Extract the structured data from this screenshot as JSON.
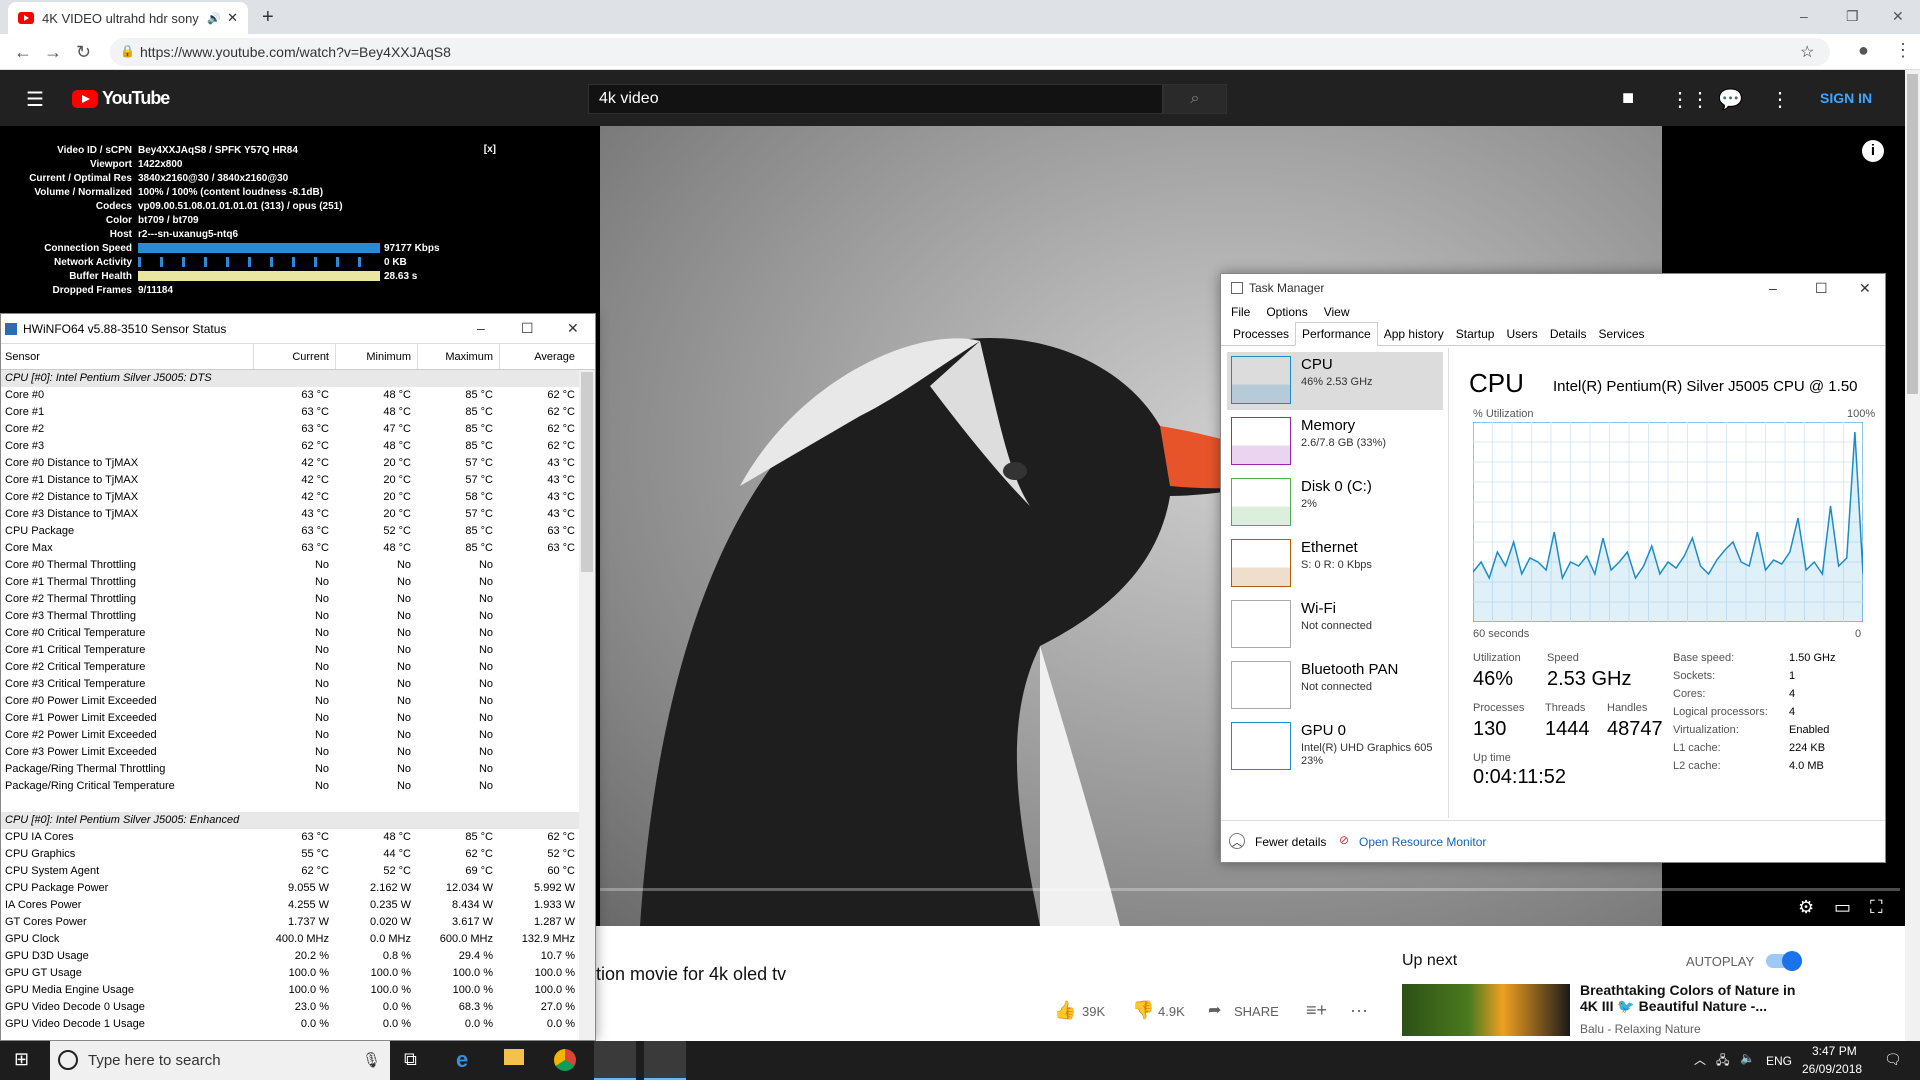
{
  "browser": {
    "tab_title": "4K VIDEO ultrahd hdr sony 4",
    "new_tab": "+",
    "url": "https://www.youtube.com/watch?v=Bey4XXJAqS8",
    "icons": {
      "back": "arrow-left",
      "forward": "arrow-right",
      "reload": "reload",
      "lock": "lock",
      "star": "star",
      "account": "account",
      "menu": "kebab"
    },
    "window_controls": [
      "–",
      "❐",
      "✕"
    ]
  },
  "youtube": {
    "logo": "YouTube",
    "search_value": "4k video",
    "signin": "SIGN IN",
    "video_title_partial": "tion movie for 4k oled tv",
    "likes": "39K",
    "dislikes": "4.9K",
    "share": "SHARE",
    "up_next": "Up next",
    "autoplay": "AUTOPLAY",
    "next_title": "Breathtaking Colors of Nature in 4K III 🐦 Beautiful Nature -...",
    "next_channel": "Balu - Relaxing Nature",
    "close_stats": "[x]"
  },
  "stats": [
    {
      "k": "Video ID / sCPN",
      "v": "Bey4XXJAqS8 / SPFK Y57Q HR84"
    },
    {
      "k": "Viewport",
      "v": "1422x800"
    },
    {
      "k": "Current / Optimal Res",
      "v": "3840x2160@30 / 3840x2160@30"
    },
    {
      "k": "Volume / Normalized",
      "v": "100% / 100% (content loudness -8.1dB)"
    },
    {
      "k": "Codecs",
      "v": "vp09.00.51.08.01.01.01.01 (313) / opus (251)"
    },
    {
      "k": "Color",
      "v": "bt709 / bt709"
    },
    {
      "k": "Host",
      "v": "r2---sn-uxanug5-ntq6"
    },
    {
      "k": "Connection Speed",
      "v": "97177 Kbps"
    },
    {
      "k": "Network Activity",
      "v": "0 KB"
    },
    {
      "k": "Buffer Health",
      "v": "28.63 s"
    },
    {
      "k": "Dropped Frames",
      "v": "9/11184"
    }
  ],
  "hwinfo": {
    "title": "HWiNFO64 v5.88-3510 Sensor Status",
    "headers": [
      "Sensor",
      "Current",
      "Minimum",
      "Maximum",
      "Average"
    ],
    "rows": [
      {
        "g": true,
        "n": "CPU [#0]: Intel Pentium Silver J5005: DTS"
      },
      {
        "n": "Core #0",
        "c": "63 °C",
        "mi": "48 °C",
        "ma": "85 °C",
        "a": "62 °C"
      },
      {
        "n": "Core #1",
        "c": "63 °C",
        "mi": "48 °C",
        "ma": "85 °C",
        "a": "62 °C"
      },
      {
        "n": "Core #2",
        "c": "63 °C",
        "mi": "47 °C",
        "ma": "85 °C",
        "a": "62 °C"
      },
      {
        "n": "Core #3",
        "c": "62 °C",
        "mi": "48 °C",
        "ma": "85 °C",
        "a": "62 °C"
      },
      {
        "n": "Core #0 Distance to TjMAX",
        "c": "42 °C",
        "mi": "20 °C",
        "ma": "57 °C",
        "a": "43 °C"
      },
      {
        "n": "Core #1 Distance to TjMAX",
        "c": "42 °C",
        "mi": "20 °C",
        "ma": "57 °C",
        "a": "43 °C"
      },
      {
        "n": "Core #2 Distance to TjMAX",
        "c": "42 °C",
        "mi": "20 °C",
        "ma": "58 °C",
        "a": "43 °C"
      },
      {
        "n": "Core #3 Distance to TjMAX",
        "c": "43 °C",
        "mi": "20 °C",
        "ma": "57 °C",
        "a": "43 °C"
      },
      {
        "n": "CPU Package",
        "c": "63 °C",
        "mi": "52 °C",
        "ma": "85 °C",
        "a": "63 °C"
      },
      {
        "n": "Core Max",
        "c": "63 °C",
        "mi": "48 °C",
        "ma": "85 °C",
        "a": "63 °C"
      },
      {
        "n": "Core #0 Thermal Throttling",
        "c": "No",
        "mi": "No",
        "ma": "No",
        "a": ""
      },
      {
        "n": "Core #1 Thermal Throttling",
        "c": "No",
        "mi": "No",
        "ma": "No",
        "a": ""
      },
      {
        "n": "Core #2 Thermal Throttling",
        "c": "No",
        "mi": "No",
        "ma": "No",
        "a": ""
      },
      {
        "n": "Core #3 Thermal Throttling",
        "c": "No",
        "mi": "No",
        "ma": "No",
        "a": ""
      },
      {
        "n": "Core #0 Critical Temperature",
        "c": "No",
        "mi": "No",
        "ma": "No",
        "a": ""
      },
      {
        "n": "Core #1 Critical Temperature",
        "c": "No",
        "mi": "No",
        "ma": "No",
        "a": ""
      },
      {
        "n": "Core #2 Critical Temperature",
        "c": "No",
        "mi": "No",
        "ma": "No",
        "a": ""
      },
      {
        "n": "Core #3 Critical Temperature",
        "c": "No",
        "mi": "No",
        "ma": "No",
        "a": ""
      },
      {
        "n": "Core #0 Power Limit Exceeded",
        "c": "No",
        "mi": "No",
        "ma": "No",
        "a": ""
      },
      {
        "n": "Core #1 Power Limit Exceeded",
        "c": "No",
        "mi": "No",
        "ma": "No",
        "a": ""
      },
      {
        "n": "Core #2 Power Limit Exceeded",
        "c": "No",
        "mi": "No",
        "ma": "No",
        "a": ""
      },
      {
        "n": "Core #3 Power Limit Exceeded",
        "c": "No",
        "mi": "No",
        "ma": "No",
        "a": ""
      },
      {
        "n": "Package/Ring Thermal Throttling",
        "c": "No",
        "mi": "No",
        "ma": "No",
        "a": ""
      },
      {
        "n": "Package/Ring Critical Temperature",
        "c": "No",
        "mi": "No",
        "ma": "No",
        "a": ""
      },
      {
        "n": "",
        "c": "",
        "mi": "",
        "ma": "",
        "a": ""
      },
      {
        "g": true,
        "n": "CPU [#0]: Intel Pentium Silver J5005: Enhanced"
      },
      {
        "n": "CPU IA Cores",
        "c": "63 °C",
        "mi": "48 °C",
        "ma": "85 °C",
        "a": "62 °C"
      },
      {
        "n": "CPU Graphics",
        "c": "55 °C",
        "mi": "44 °C",
        "ma": "62 °C",
        "a": "52 °C"
      },
      {
        "n": "CPU System Agent",
        "c": "62 °C",
        "mi": "52 °C",
        "ma": "69 °C",
        "a": "60 °C"
      },
      {
        "n": "CPU Package Power",
        "c": "9.055 W",
        "mi": "2.162 W",
        "ma": "12.034 W",
        "a": "5.992 W"
      },
      {
        "n": "IA Cores Power",
        "c": "4.255 W",
        "mi": "0.235 W",
        "ma": "8.434 W",
        "a": "1.933 W"
      },
      {
        "n": "GT Cores Power",
        "c": "1.737 W",
        "mi": "0.020 W",
        "ma": "3.617 W",
        "a": "1.287 W"
      },
      {
        "n": "GPU Clock",
        "c": "400.0 MHz",
        "mi": "0.0 MHz",
        "ma": "600.0 MHz",
        "a": "132.9 MHz"
      },
      {
        "n": "GPU D3D Usage",
        "c": "20.2 %",
        "mi": "0.8 %",
        "ma": "29.4 %",
        "a": "10.7 %"
      },
      {
        "n": "GPU GT Usage",
        "c": "100.0 %",
        "mi": "100.0 %",
        "ma": "100.0 %",
        "a": "100.0 %"
      },
      {
        "n": "GPU Media Engine Usage",
        "c": "100.0 %",
        "mi": "100.0 %",
        "ma": "100.0 %",
        "a": "100.0 %"
      },
      {
        "n": "GPU Video Decode 0 Usage",
        "c": "23.0 %",
        "mi": "0.0 %",
        "ma": "68.3 %",
        "a": "27.0 %"
      },
      {
        "n": "GPU Video Decode 1 Usage",
        "c": "0.0 %",
        "mi": "0.0 %",
        "ma": "0.0 %",
        "a": "0.0 %"
      }
    ]
  },
  "taskmanager": {
    "title": "Task Manager",
    "menu": [
      "File",
      "Options",
      "View"
    ],
    "tabs": [
      "Processes",
      "Performance",
      "App history",
      "Startup",
      "Users",
      "Details",
      "Services"
    ],
    "side": [
      {
        "n": "CPU",
        "s": "46% 2.53 GHz",
        "color": "#1a8cc8"
      },
      {
        "n": "Memory",
        "s": "2.6/7.8 GB (33%)",
        "color": "#9b26af"
      },
      {
        "n": "Disk 0 (C:)",
        "s": "2%",
        "color": "#4caf50"
      },
      {
        "n": "Ethernet",
        "s": "S: 0 R: 0 Kbps",
        "color": "#b35c00"
      },
      {
        "n": "Wi-Fi",
        "s": "Not connected",
        "color": "#aaaaaa"
      },
      {
        "n": "Bluetooth PAN",
        "s": "Not connected",
        "color": "#aaaaaa"
      },
      {
        "n": "GPU 0",
        "s": "Intel(R) UHD Graphics 605",
        "s2": "23%",
        "color": "#1a8cc8"
      }
    ],
    "cpu_title": "CPU",
    "cpu_model": "Intel(R) Pentium(R) Silver J5005 CPU @ 1.50",
    "util_label": "% Utilization",
    "pct100": "100%",
    "seconds": "60 seconds",
    "zero": "0",
    "stats": {
      "utilization_l": "Utilization",
      "utilization": "46%",
      "speed_l": "Speed",
      "speed": "2.53 GHz",
      "processes_l": "Processes",
      "processes": "130",
      "threads_l": "Threads",
      "threads": "1444",
      "handles_l": "Handles",
      "handles": "48747",
      "uptime_l": "Up time",
      "uptime": "0:04:11:52"
    },
    "specs": [
      [
        "Base speed:",
        "1.50 GHz"
      ],
      [
        "Sockets:",
        "1"
      ],
      [
        "Cores:",
        "4"
      ],
      [
        "Logical processors:",
        "4"
      ],
      [
        "Virtualization:",
        "Enabled"
      ],
      [
        "L1 cache:",
        "224 KB"
      ],
      [
        "L2 cache:",
        "4.0 MB"
      ]
    ],
    "fewer": "Fewer details",
    "resmon": "Open Resource Monitor"
  },
  "chart_data": {
    "type": "line",
    "title": "CPU",
    "ylabel": "% Utilization",
    "xlabel": "60 seconds",
    "ylim": [
      0,
      100
    ],
    "values": [
      25,
      30,
      22,
      35,
      28,
      40,
      24,
      32,
      30,
      26,
      45,
      22,
      30,
      28,
      33,
      24,
      42,
      26,
      30,
      35,
      22,
      28,
      38,
      24,
      30,
      27,
      33,
      42,
      28,
      24,
      31,
      36,
      40,
      30,
      28,
      45,
      26,
      31,
      29,
      35,
      52,
      26,
      30,
      24,
      58,
      28,
      32,
      95,
      24
    ]
  },
  "taskbar": {
    "search": "Type here to search",
    "lang": "ENG",
    "time": "3:47 PM",
    "date": "26/09/2018"
  }
}
